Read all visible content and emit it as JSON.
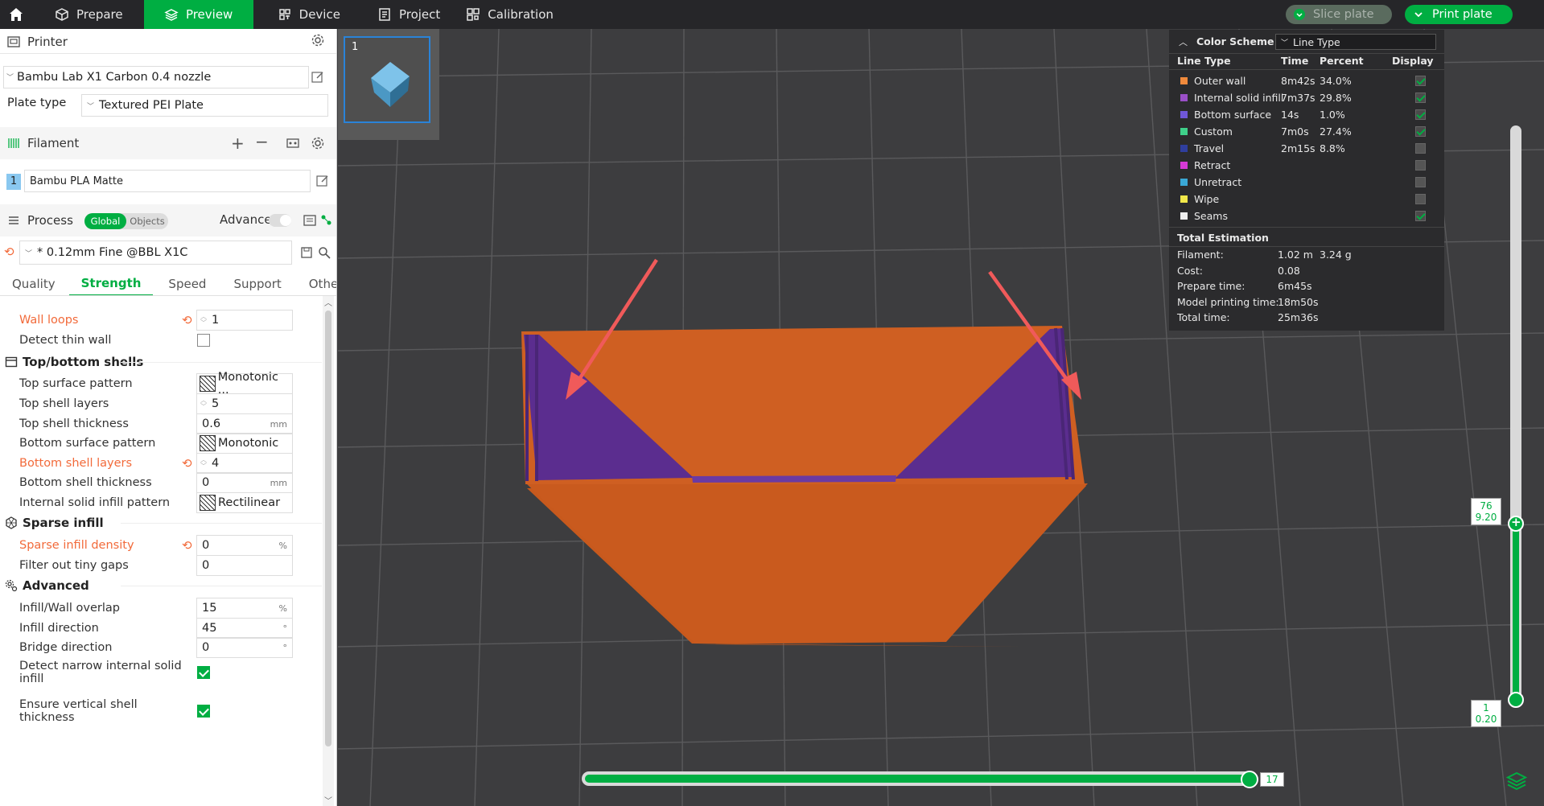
{
  "topbar": {
    "tabs": [
      {
        "label": "Prepare"
      },
      {
        "label": "Preview"
      },
      {
        "label": "Device"
      },
      {
        "label": "Project"
      },
      {
        "label": "Calibration"
      }
    ],
    "slice_label": "Slice plate",
    "print_label": "Print plate"
  },
  "sidebar": {
    "printer_heading": "Printer",
    "printer_name": "Bambu Lab X1 Carbon 0.4 nozzle",
    "plate_type_label": "Plate type",
    "plate_type_value": "Textured PEI Plate",
    "filament_heading": "Filament",
    "filament_index": "1",
    "filament_name": "Bambu PLA Matte",
    "process_heading": "Process",
    "global_label": "Global",
    "objects_label": "Objects",
    "advance_label": "Advance",
    "process_profile": "* 0.12mm Fine @BBL X1C",
    "tabs": [
      "Quality",
      "Strength",
      "Speed",
      "Support",
      "Others"
    ],
    "active_tab": "Strength",
    "settings": {
      "wall_loops": {
        "label": "Wall loops",
        "value": "1"
      },
      "detect_thin_wall": {
        "label": "Detect thin wall",
        "checked": false
      },
      "top_bottom_group": "Top/bottom shells",
      "top_surface_pattern": {
        "label": "Top surface pattern",
        "value": "Monotonic ..."
      },
      "top_shell_layers": {
        "label": "Top shell layers",
        "value": "5"
      },
      "top_shell_thickness": {
        "label": "Top shell thickness",
        "value": "0.6",
        "unit": "mm"
      },
      "bottom_surface_pattern": {
        "label": "Bottom surface pattern",
        "value": "Monotonic"
      },
      "bottom_shell_layers": {
        "label": "Bottom shell layers",
        "value": "4"
      },
      "bottom_shell_thickness": {
        "label": "Bottom shell thickness",
        "value": "0",
        "unit": "mm"
      },
      "internal_solid_infill_pattern": {
        "label": "Internal solid infill pattern",
        "value": "Rectilinear"
      },
      "sparse_group": "Sparse infill",
      "sparse_infill_density": {
        "label": "Sparse infill density",
        "value": "0",
        "unit": "%"
      },
      "filter_tiny_gaps": {
        "label": "Filter out tiny gaps",
        "value": "0"
      },
      "advanced_group": "Advanced",
      "infill_wall_overlap": {
        "label": "Infill/Wall overlap",
        "value": "15",
        "unit": "%"
      },
      "infill_direction": {
        "label": "Infill direction",
        "value": "45",
        "unit": "°"
      },
      "bridge_direction": {
        "label": "Bridge direction",
        "value": "0",
        "unit": "°"
      },
      "detect_narrow_internal": {
        "label_1": "Detect narrow internal solid",
        "label_2": "infill",
        "checked": true
      },
      "ensure_vertical_shell": {
        "label_1": "Ensure vertical shell",
        "label_2": "thickness",
        "checked": true
      }
    }
  },
  "plate_thumbnail": {
    "number": "1"
  },
  "legend": {
    "title": "Color Scheme",
    "scheme": "Line Type",
    "headers": {
      "type": "Line Type",
      "time": "Time",
      "percent": "Percent",
      "display": "Display"
    },
    "rows": [
      {
        "name": "Outer wall",
        "time": "8m42s",
        "percent": "34.0%",
        "color": "#f08a3c",
        "display": true
      },
      {
        "name": "Internal solid infill",
        "time": "7m37s",
        "percent": "29.8%",
        "color": "#9a4fc7",
        "display": true
      },
      {
        "name": "Bottom surface",
        "time": "14s",
        "percent": "1.0%",
        "color": "#6f57d8",
        "display": true
      },
      {
        "name": "Custom",
        "time": "7m0s",
        "percent": "27.4%",
        "color": "#3fd08a",
        "display": true
      },
      {
        "name": "Travel",
        "time": "2m15s",
        "percent": "8.8%",
        "color": "#2f3e9e",
        "display": false
      },
      {
        "name": "Retract",
        "time": "",
        "percent": "",
        "color": "#d63ad6",
        "display": false
      },
      {
        "name": "Unretract",
        "time": "",
        "percent": "",
        "color": "#3aa8d6",
        "display": false
      },
      {
        "name": "Wipe",
        "time": "",
        "percent": "",
        "color": "#f2e84a",
        "display": false
      },
      {
        "name": "Seams",
        "time": "",
        "percent": "",
        "color": "#eeeeee",
        "display": true
      }
    ],
    "estimation_title": "Total Estimation",
    "estimation": [
      {
        "key": "Filament:",
        "value": "1.02 m",
        "value2": "3.24 g"
      },
      {
        "key": "Cost:",
        "value": "0.08",
        "value2": ""
      },
      {
        "key": "Prepare time:",
        "value": "6m45s",
        "value2": ""
      },
      {
        "key": "Model printing time:",
        "value": "18m50s",
        "value2": ""
      },
      {
        "key": "Total time:",
        "value": "25m36s",
        "value2": ""
      }
    ]
  },
  "layer_slider": {
    "top_layer": "76",
    "top_height": "9.20",
    "bottom_layer": "1",
    "bottom_height": "0.20"
  },
  "move_slider": {
    "value": "17"
  },
  "colors": {
    "accent": "#00ae42",
    "outer_wall": "#c95a1e",
    "infill": "#5b2d8f",
    "annotation_arrow": "#f05a5a",
    "modified_text": "#f26a3a"
  }
}
